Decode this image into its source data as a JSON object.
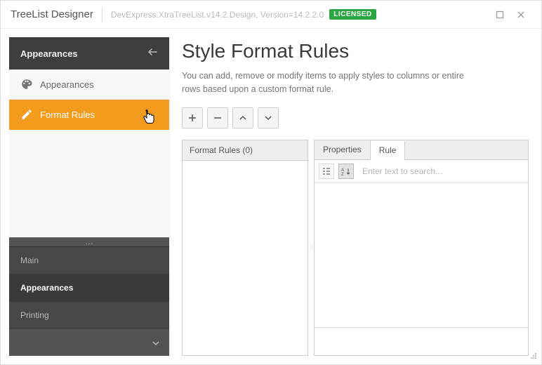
{
  "titlebar": {
    "app_title": "TreeList Designer",
    "assembly": "DevExpress.XtraTreeList.v14.2.Design, Version=14.2.2.0",
    "license": "LICENSED"
  },
  "sidebar": {
    "header": "Appearances",
    "items": [
      {
        "label": "Appearances"
      },
      {
        "label": "Format Rules"
      }
    ],
    "categories": [
      {
        "label": "Main"
      },
      {
        "label": "Appearances"
      },
      {
        "label": "Printing"
      }
    ]
  },
  "page": {
    "title": "Style Format Rules",
    "description": "You can add, remove or modify items to apply styles to columns or entire rows based upon a custom format rule."
  },
  "rules_panel": {
    "header": "Format Rules (0)"
  },
  "props_panel": {
    "tabs": {
      "properties": "Properties",
      "rule": "Rule"
    },
    "search_placeholder": "Enter text to search..."
  }
}
